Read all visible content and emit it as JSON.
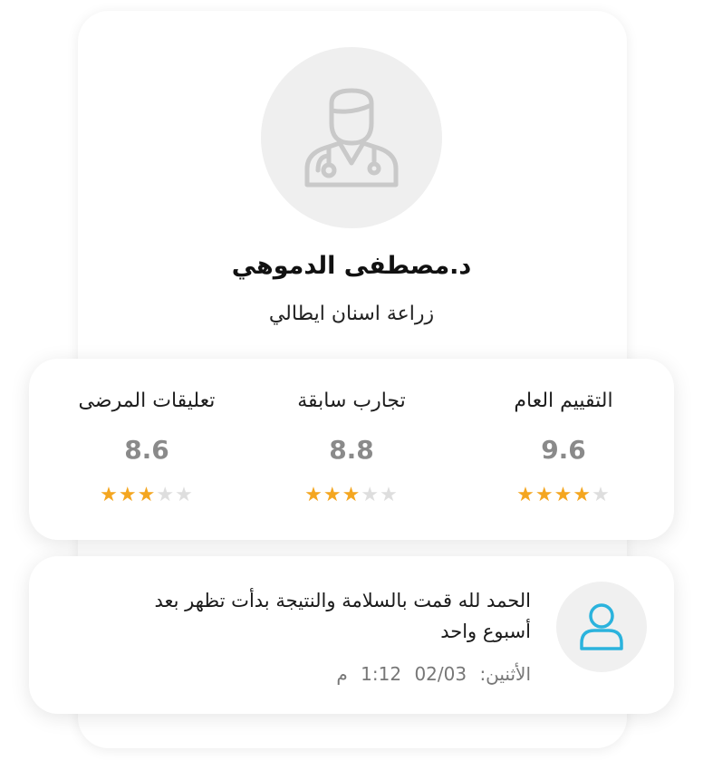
{
  "doctor": {
    "name": "د.مصطفى الدموهي",
    "specialty": "زراعة اسنان ايطالي",
    "avatar_icon": "doctor-icon"
  },
  "stats": [
    {
      "label": "التقييم العام",
      "value": "9.6",
      "rating": 4,
      "max": 5
    },
    {
      "label": "تجارب سابقة",
      "value": "8.8",
      "rating": 3,
      "max": 5
    },
    {
      "label": "تعليقات المرضى",
      "value": "8.6",
      "rating": 3,
      "max": 5
    }
  ],
  "review": {
    "text": "الحمد لله قمت بالسلامة والنتيجة بدأت تظهر بعد أسبوع واحد",
    "day": "الأثنين:",
    "date": "02/03",
    "time": "1:12",
    "period": "م",
    "avatar_icon": "user-icon"
  },
  "colors": {
    "star_full": "#f4a620",
    "star_empty": "#dedede",
    "user_icon": "#2bb3dd",
    "doctor_icon": "#c9c9c9"
  }
}
